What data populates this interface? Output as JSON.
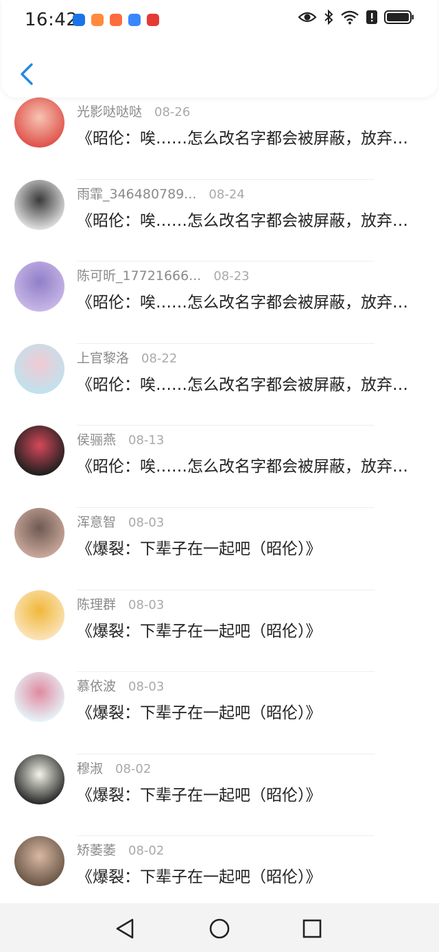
{
  "status_bar": {
    "time": "16:42",
    "notification_icons": [
      {
        "name": "shield-check-icon",
        "color": "#1a73e8"
      },
      {
        "name": "video-app-icon",
        "color": "#ff8a3d"
      },
      {
        "name": "book-app-icon",
        "color": "#ff6b3d"
      },
      {
        "name": "browser-app-icon",
        "color": "#3a86ff"
      },
      {
        "name": "huawei-app-icon",
        "color": "#e53935"
      }
    ],
    "system_icons": [
      "eye-icon",
      "bluetooth-icon",
      "wifi-icon",
      "alert-icon",
      "battery-icon"
    ]
  },
  "header": {
    "back_icon": "chevron-left-icon",
    "accent": "#1e88e5"
  },
  "messages": [
    {
      "name": "光影哒哒哒",
      "date": "08-26",
      "text": "《昭伦：唉……怎么改名字都会被屏蔽，放弃了》",
      "avatar_colors": [
        "#e0524a",
        "#f6c4b4"
      ]
    },
    {
      "name": "雨霏_346480789...",
      "date": "08-24",
      "text": "《昭伦：唉……怎么改名字都会被屏蔽，放弃了》",
      "avatar_colors": [
        "#dedede",
        "#3a3a3a"
      ]
    },
    {
      "name": "陈可昕_17721666...",
      "date": "08-23",
      "text": "《昭伦：唉……怎么改名字都会被屏蔽，放弃了》",
      "avatar_colors": [
        "#c7b6e6",
        "#8f7fc8"
      ]
    },
    {
      "name": "上官黎洛",
      "date": "08-22",
      "text": "《昭伦：唉……怎么改名字都会被屏蔽，放弃了》",
      "avatar_colors": [
        "#bfe2ee",
        "#f2c9d2"
      ]
    },
    {
      "name": "侯骊燕",
      "date": "08-13",
      "text": "《昭伦：唉……怎么改名字都会被屏蔽，放弃了》",
      "avatar_colors": [
        "#1f1f1f",
        "#d6485a"
      ]
    },
    {
      "name": "浑意智",
      "date": "08-03",
      "text": "《爆裂：下辈子在一起吧（昭伦）》",
      "avatar_colors": [
        "#c9a79a",
        "#6e5a52"
      ]
    },
    {
      "name": "陈理群",
      "date": "08-03",
      "text": "《爆裂：下辈子在一起吧（昭伦）》",
      "avatar_colors": [
        "#fbe3b8",
        "#f0b83a"
      ]
    },
    {
      "name": "慕依波",
      "date": "08-03",
      "text": "《爆裂：下辈子在一起吧（昭伦）》",
      "avatar_colors": [
        "#e6f3f8",
        "#e08aa0"
      ]
    },
    {
      "name": "穆淑",
      "date": "08-02",
      "text": "《爆裂：下辈子在一起吧（昭伦）》",
      "avatar_colors": [
        "#2a2a2a",
        "#f4f4ea"
      ]
    },
    {
      "name": "矫萎萎",
      "date": "08-02",
      "text": "《爆裂：下辈子在一起吧（昭伦）》",
      "avatar_colors": [
        "#6b5647",
        "#d8b9a3"
      ]
    }
  ],
  "nav_bar": {
    "buttons": [
      "back-triangle-icon",
      "home-circle-icon",
      "recents-square-icon"
    ]
  }
}
